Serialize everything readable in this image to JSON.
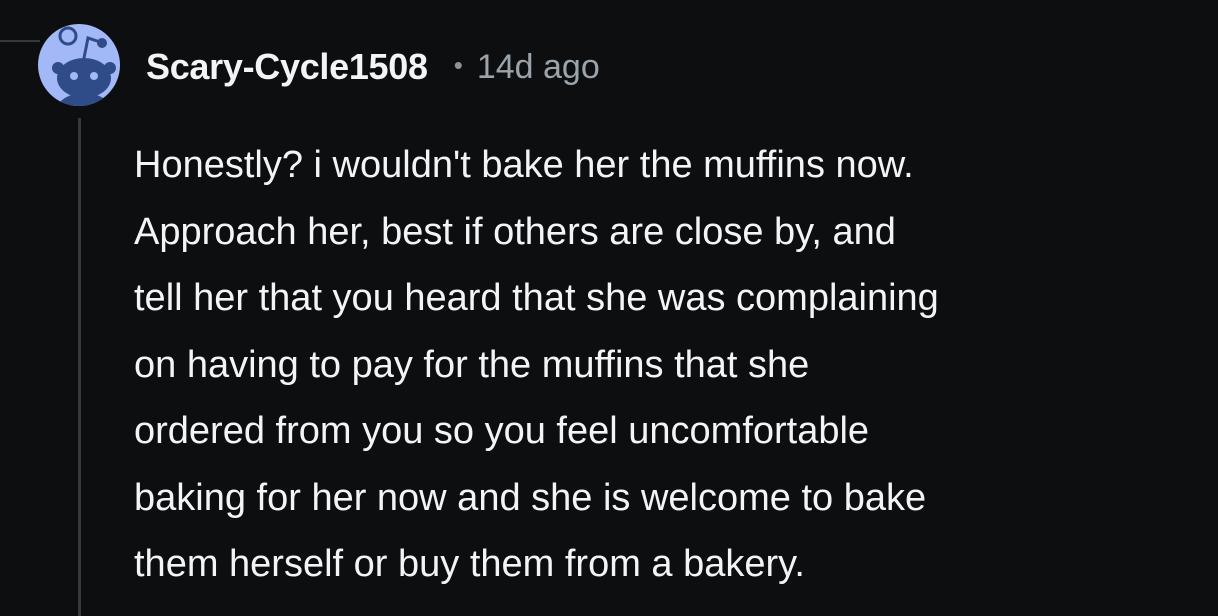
{
  "comment": {
    "username": "Scary-Cycle1508",
    "separator": "•",
    "timestamp": "14d ago",
    "avatar_icon": "snoo-avatar-icon",
    "lines": [
      "Honestly? i wouldn't bake her the muffins now.",
      "Approach her, best if others are close by, and",
      "tell her that you heard that she was complaining",
      "on having to pay for the muffins that she",
      "ordered from you so you feel uncomfortable",
      "baking for her now and she is welcome to bake",
      "them herself or buy them from a bakery."
    ]
  },
  "colors": {
    "background": "#0c0e10",
    "avatar_bg": "#a2b8f7",
    "text": "#f2f4f5",
    "muted": "#9ba4aa"
  }
}
